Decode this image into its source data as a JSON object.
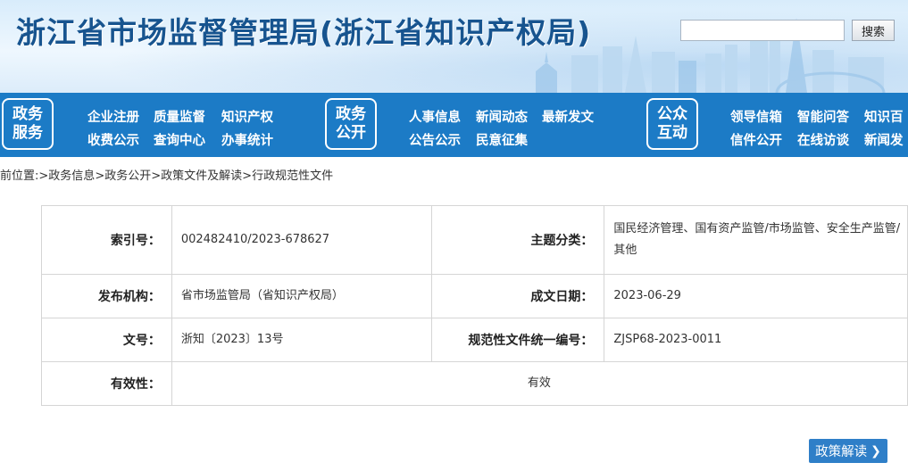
{
  "header": {
    "site_title": "浙江省市场监督管理局(浙江省知识产权局)",
    "search_placeholder": "",
    "search_button": "搜索"
  },
  "nav": {
    "groups": [
      {
        "badge": [
          "政务",
          "服务"
        ],
        "links": [
          "企业注册",
          "质量监督",
          "知识产权",
          "收费公示",
          "查询中心",
          "办事统计"
        ]
      },
      {
        "badge": [
          "政务",
          "公开"
        ],
        "links": [
          "人事信息",
          "新闻动态",
          "最新发文",
          "公告公示",
          "民意征集"
        ]
      },
      {
        "badge": [
          "公众",
          "互动"
        ],
        "links": [
          "领导信箱",
          "智能问答",
          "知识百",
          "信件公开",
          "在线访谈",
          "新闻发"
        ]
      }
    ]
  },
  "breadcrumb": {
    "prefix": "前位置:",
    "items": [
      "政务信息",
      "政务公开",
      "政策文件及解读",
      "行政规范性文件"
    ],
    "separator": ">"
  },
  "info": {
    "index_label": "索引号：",
    "index_value": "002482410/2023-678627",
    "topic_label": "主题分类：",
    "topic_value": "国民经济管理、国有资产监管/市场监管、安全生产监管/其他",
    "publisher_label": "发布机构：",
    "publisher_value": "省市场监管局（省知识产权局）",
    "date_label": "成文日期：",
    "date_value": "2023-06-29",
    "doc_no_label": "文号：",
    "doc_no_value": "浙知〔2023〕13号",
    "code_label": "规范性文件统一编号：",
    "code_value": "ZJSP68-2023-0011",
    "validity_label": "有效性：",
    "validity_value": "有效"
  },
  "policy_button": {
    "label": "政策解读",
    "icon": "chevron-right-icon"
  },
  "colors": {
    "nav_bg": "#1c7bc6",
    "title": "#17548f",
    "button_bg": "#2f7fc8"
  }
}
